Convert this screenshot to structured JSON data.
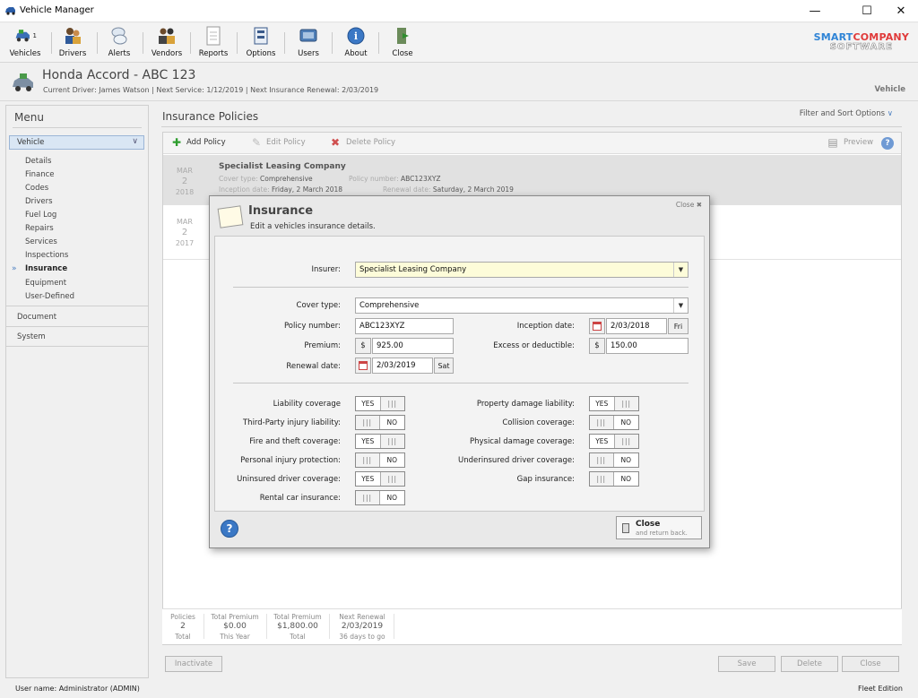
{
  "window": {
    "title": "Vehicle Manager"
  },
  "toolbar": {
    "items": [
      {
        "label": "Vehicles",
        "badge": "1",
        "icon": "vehicles-icon"
      },
      {
        "label": "Drivers",
        "icon": "drivers-icon"
      },
      {
        "label": "Alerts",
        "icon": "alerts-icon"
      },
      {
        "label": "Vendors",
        "icon": "vendors-icon"
      },
      {
        "label": "Reports",
        "icon": "reports-icon"
      },
      {
        "label": "Options",
        "icon": "options-icon"
      },
      {
        "label": "Users",
        "icon": "users-icon"
      },
      {
        "label": "About",
        "icon": "about-icon"
      },
      {
        "label": "Close",
        "icon": "close-app-icon"
      }
    ],
    "logo_line1a": "SMART",
    "logo_line1b": "COMPANY",
    "logo_line2": "SOFTWARE"
  },
  "vehicle": {
    "title": "Honda Accord - ABC 123",
    "subtitle": "Current Driver: James Watson  |  Next Service: 1/12/2019  |  Next Insurance Renewal: 2/03/2019",
    "section": "Vehicle"
  },
  "menu": {
    "heading": "Menu",
    "selected": "Vehicle",
    "items": [
      "Details",
      "Finance",
      "Codes",
      "Drivers",
      "Fuel Log",
      "Repairs",
      "Services",
      "Inspections",
      "Insurance",
      "Equipment",
      "User-Defined"
    ],
    "active_index": 8,
    "groups": [
      "Document",
      "System"
    ]
  },
  "main": {
    "heading": "Insurance Policies",
    "filter_label": "Filter and Sort Options",
    "list_toolbar": {
      "add": "Add Policy",
      "edit": "Edit Policy",
      "delete": "Delete Policy",
      "preview": "Preview"
    },
    "rows": [
      {
        "month": "MAR",
        "day": "2",
        "year": "2018",
        "company": "Specialist Leasing Company",
        "cover_label": "Cover type:",
        "cover": "Comprehensive",
        "policy_label": "Policy number:",
        "policy": "ABC123XYZ",
        "inception_label": "Inception date:",
        "inception": "Friday, 2 March 2018",
        "renewal_label": "Renewal date:",
        "renewal": "Saturday, 2 March 2019"
      },
      {
        "month": "MAR",
        "day": "2",
        "year": "2017"
      }
    ],
    "stats": [
      {
        "top": "Policies",
        "value": "2",
        "bottom": "Total"
      },
      {
        "top": "Total Premium",
        "value": "$0.00",
        "bottom": "This Year"
      },
      {
        "top": "Total Premium",
        "value": "$1,800.00",
        "bottom": "Total"
      },
      {
        "top": "Next Renewal",
        "value": "2/03/2019",
        "bottom": "36 days to go"
      }
    ],
    "buttons": {
      "inactivate": "Inactivate",
      "save": "Save",
      "delete": "Delete",
      "close": "Close"
    }
  },
  "dialog": {
    "title": "Insurance",
    "subtitle": "Edit a vehicles insurance details.",
    "close_label": "Close",
    "insurer_label": "Insurer:",
    "insurer": "Specialist Leasing Company",
    "cover_label": "Cover type:",
    "cover": "Comprehensive",
    "policy_label": "Policy number:",
    "policy": "ABC123XYZ",
    "inception_label": "Inception date:",
    "inception": "2/03/2018",
    "inception_day": "Fri",
    "premium_label": "Premium:",
    "premium_prefix": "$",
    "premium": "925.00",
    "excess_label": "Excess or deductible:",
    "excess_prefix": "$",
    "excess": "150.00",
    "renewal_label": "Renewal date:",
    "renewal": "2/03/2019",
    "renewal_day": "Sat",
    "yes_text": "YES",
    "no_text": "NO",
    "grip": "|||",
    "coverages_left": [
      {
        "label": "Liability coverage",
        "on": true
      },
      {
        "label": "Third-Party injury liability:",
        "on": false
      },
      {
        "label": "Fire and theft coverage:",
        "on": true
      },
      {
        "label": "Personal injury protection:",
        "on": false
      },
      {
        "label": "Uninsured driver coverage:",
        "on": true
      },
      {
        "label": "Rental car insurance:",
        "on": false
      }
    ],
    "coverages_right": [
      {
        "label": "Property damage liability:",
        "on": true
      },
      {
        "label": "Collision coverage:",
        "on": false
      },
      {
        "label": "Physical damage coverage:",
        "on": true
      },
      {
        "label": "Underinsured driver coverage:",
        "on": false
      },
      {
        "label": "Gap insurance:",
        "on": false
      }
    ],
    "close_button": {
      "title": "Close",
      "sub": "and return back."
    }
  },
  "status": {
    "user": "User name:  Administrator (ADMIN)",
    "edition": "Fleet Edition"
  }
}
